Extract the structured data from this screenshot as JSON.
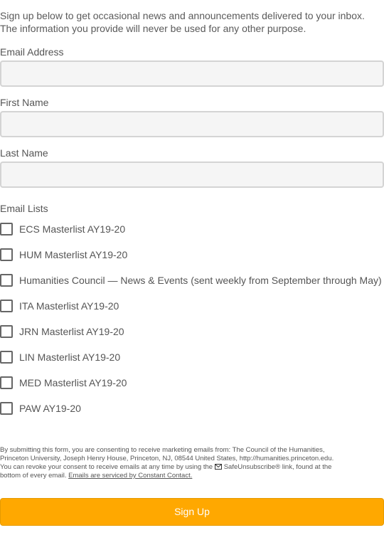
{
  "intro": {
    "line1": "Sign up below to get occasional news and announcements delivered to your inbox.",
    "line2": "The information you provide will never be used for any other purpose."
  },
  "fields": {
    "email_label": "Email Address",
    "email_value": "",
    "first_name_label": "First Name",
    "first_name_value": "",
    "last_name_label": "Last Name",
    "last_name_value": ""
  },
  "lists": {
    "heading": "Email Lists",
    "items": [
      {
        "label": "ECS Masterlist AY19-20",
        "checked": false
      },
      {
        "label": "HUM Masterlist AY19-20",
        "checked": false
      },
      {
        "label": "Humanities Council — News & Events (sent weekly from September through May)",
        "checked": false
      },
      {
        "label": "ITA Masterlist AY19-20",
        "checked": false
      },
      {
        "label": "JRN Masterlist AY19-20",
        "checked": false
      },
      {
        "label": "LIN Masterlist AY19-20",
        "checked": false
      },
      {
        "label": "MED Masterlist AY19-20",
        "checked": false
      },
      {
        "label": "PAW AY19-20",
        "checked": false
      }
    ]
  },
  "legal": {
    "line1": "By submitting this form, you are consenting to receive marketing emails from: The Council of the Humanities,",
    "line2": "Princeton University, Joseph Henry House, Princeton, NJ, 08544 United States, http://humanities.princeton.edu.",
    "line3_pre": "You can revoke your consent to receive emails at any time by using the",
    "line3_link": "SafeUnsubscribe® link, found at the",
    "line4_pre": "bottom of every email.",
    "line4_link": "Emails are serviced by Constant Contact."
  },
  "submit": {
    "label": "Sign Up"
  },
  "colors": {
    "button": "#ffa800",
    "field_bg": "#f5f5f5",
    "field_border": "#d4d4d4"
  }
}
